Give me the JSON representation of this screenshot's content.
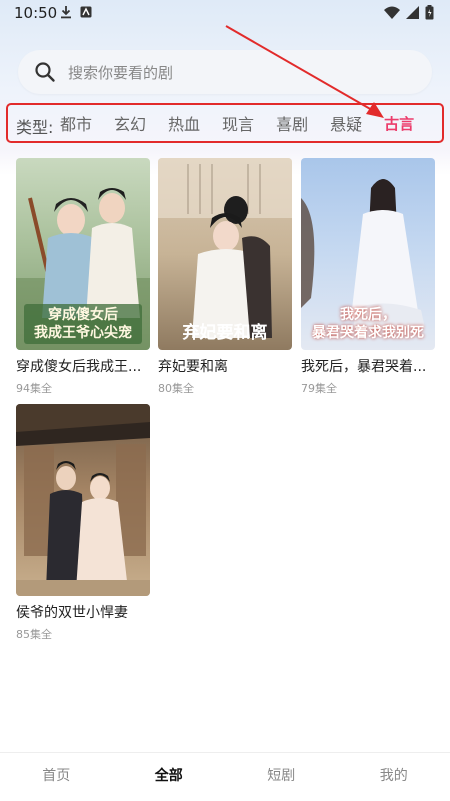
{
  "status_bar": {
    "time": "10:50",
    "icons_left": [
      "download-icon",
      "app-notification-icon"
    ],
    "icons_right": [
      "wifi-icon",
      "signal-icon",
      "battery-icon"
    ]
  },
  "search": {
    "placeholder": "搜索你要看的剧",
    "value": ""
  },
  "type_filter": {
    "label": "类型:",
    "items": [
      {
        "label": "都市"
      },
      {
        "label": "玄幻"
      },
      {
        "label": "热血"
      },
      {
        "label": "现言"
      },
      {
        "label": "喜剧"
      },
      {
        "label": "悬疑"
      },
      {
        "label": "古言"
      }
    ],
    "selected": "古言"
  },
  "dramas": [
    {
      "title": "穿成傻女后我成王...",
      "episodes": "94集全",
      "poster_caption": "穿成傻女后\n我成王爷心尖宠"
    },
    {
      "title": "弃妃要和离",
      "episodes": "80集全",
      "poster_caption": "弃妃要和离"
    },
    {
      "title": "我死后，暴君哭着...",
      "episodes": "79集全",
      "poster_caption": "我死后，\n暴君哭着求我别死"
    },
    {
      "title": "侯爷的双世小悍妻",
      "episodes": "85集全",
      "poster_caption": ""
    }
  ],
  "bottom_nav": {
    "items": [
      {
        "label": "首页"
      },
      {
        "label": "全部"
      },
      {
        "label": "短剧"
      },
      {
        "label": "我的"
      }
    ],
    "active": "全部"
  },
  "colors": {
    "accent": "#ec3c6b",
    "annotation_red": "#e22b2b"
  }
}
